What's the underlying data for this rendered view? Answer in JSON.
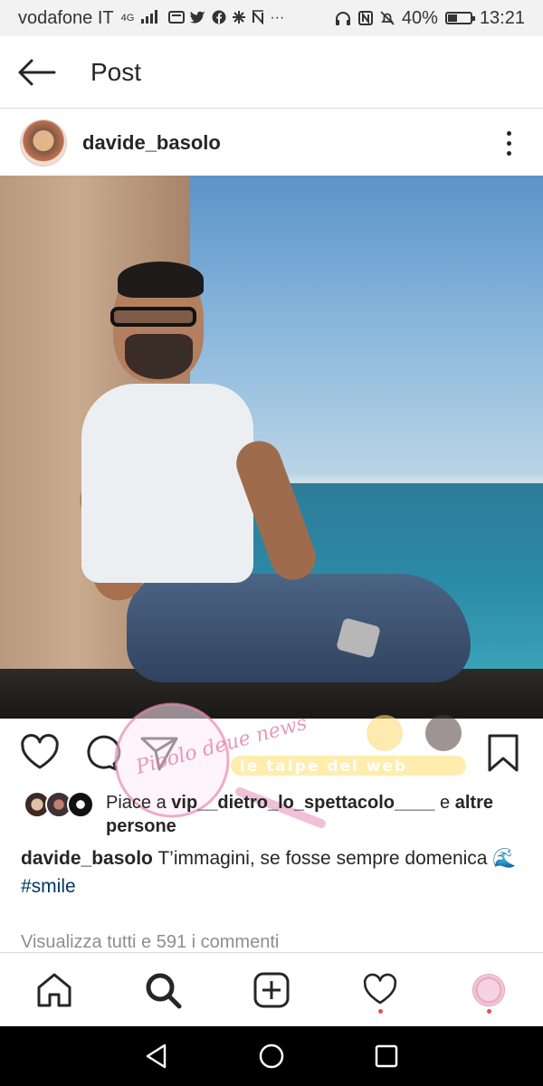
{
  "status_bar": {
    "carrier": "vodafone IT",
    "network": "4G",
    "battery": "40%",
    "battery_level": 0.4,
    "time": "13:21"
  },
  "header": {
    "title": "Post"
  },
  "post": {
    "username": "davide_basolo",
    "likes": {
      "prefix": "Piace a ",
      "liker": "vip__dietro_lo_spettacolo____",
      "middle": " e ",
      "suffix": "altre persone"
    },
    "caption": {
      "username": "davide_basolo",
      "text": " T’immagini, se fosse sempre domenica 🌊",
      "hashtag": "#smile"
    },
    "view_comments": "Visualizza tutti e 591 i commenti"
  },
  "watermark": {
    "circle_text": "Pioolo deue news",
    "banner_text": "le talpe del web"
  },
  "nav": {
    "items": [
      "home",
      "search",
      "new-post",
      "activity",
      "profile"
    ]
  },
  "icons": {
    "back": "arrow-left-icon",
    "more": "more-vertical-icon",
    "like": "heart-icon",
    "comment": "comment-icon",
    "share": "send-icon",
    "save": "bookmark-icon"
  },
  "colors": {
    "link": "#00376b",
    "notification_dot": "#ed4956",
    "muted": "#8e8e8e"
  }
}
